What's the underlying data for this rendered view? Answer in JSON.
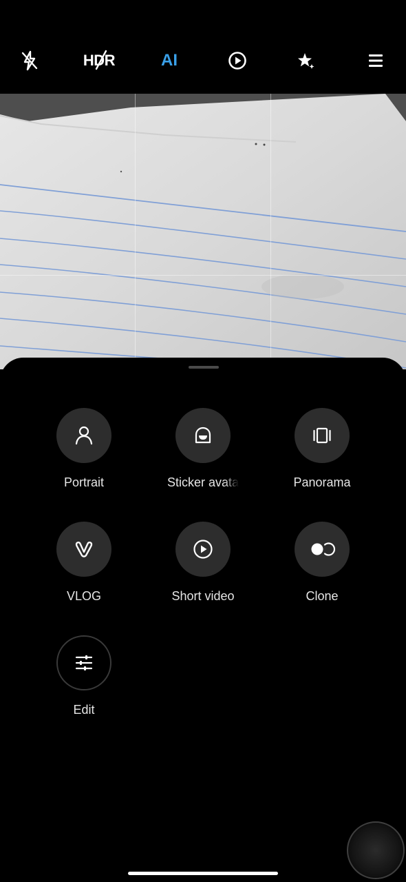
{
  "topbar": {
    "items": [
      {
        "name": "flash-off-icon"
      },
      {
        "name": "hdr-toggle",
        "label": "HDR"
      },
      {
        "name": "ai-toggle",
        "label": "AI",
        "color": "#3aa0e8"
      },
      {
        "name": "motion-photo-icon"
      },
      {
        "name": "beauty-icon"
      },
      {
        "name": "menu-icon"
      }
    ]
  },
  "modes": [
    {
      "label": "Portrait",
      "icon": "portrait-icon"
    },
    {
      "label": "Sticker avatar",
      "icon": "sticker-avatar-icon"
    },
    {
      "label": "Panorama",
      "icon": "panorama-icon"
    },
    {
      "label": "VLOG",
      "icon": "vlog-icon"
    },
    {
      "label": "Short video",
      "icon": "short-video-icon"
    },
    {
      "label": "Clone",
      "icon": "clone-icon"
    },
    {
      "label": "Edit",
      "icon": "edit-sliders-icon"
    }
  ],
  "colors": {
    "accent": "#3aa0e8",
    "sheet": "#000000",
    "mode_button": "#2d2d2d"
  }
}
